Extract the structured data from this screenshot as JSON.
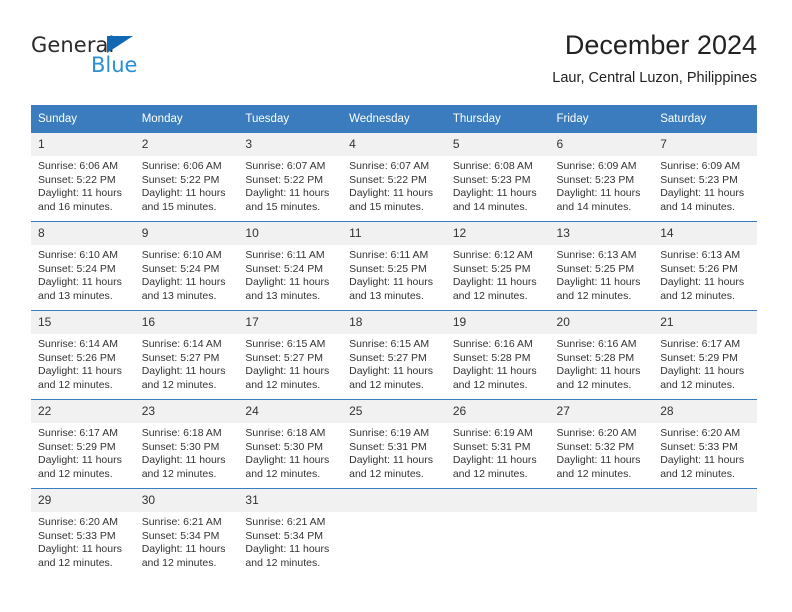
{
  "brand": {
    "name_part1": "General",
    "name_part2": "Blue",
    "triangle_color": "#1268b3",
    "blue_color": "#2a8fd4"
  },
  "header": {
    "title": "December 2024",
    "subtitle": "Laur, Central Luzon, Philippines"
  },
  "calendar": {
    "accent_color": "#3a7cbd",
    "daynum_bg": "#f1f1f1",
    "weekdays": [
      "Sunday",
      "Monday",
      "Tuesday",
      "Wednesday",
      "Thursday",
      "Friday",
      "Saturday"
    ],
    "weeks": [
      [
        {
          "day": "1",
          "sunrise": "Sunrise: 6:06 AM",
          "sunset": "Sunset: 5:22 PM",
          "daylight1": "Daylight: 11 hours",
          "daylight2": "and 16 minutes."
        },
        {
          "day": "2",
          "sunrise": "Sunrise: 6:06 AM",
          "sunset": "Sunset: 5:22 PM",
          "daylight1": "Daylight: 11 hours",
          "daylight2": "and 15 minutes."
        },
        {
          "day": "3",
          "sunrise": "Sunrise: 6:07 AM",
          "sunset": "Sunset: 5:22 PM",
          "daylight1": "Daylight: 11 hours",
          "daylight2": "and 15 minutes."
        },
        {
          "day": "4",
          "sunrise": "Sunrise: 6:07 AM",
          "sunset": "Sunset: 5:22 PM",
          "daylight1": "Daylight: 11 hours",
          "daylight2": "and 15 minutes."
        },
        {
          "day": "5",
          "sunrise": "Sunrise: 6:08 AM",
          "sunset": "Sunset: 5:23 PM",
          "daylight1": "Daylight: 11 hours",
          "daylight2": "and 14 minutes."
        },
        {
          "day": "6",
          "sunrise": "Sunrise: 6:09 AM",
          "sunset": "Sunset: 5:23 PM",
          "daylight1": "Daylight: 11 hours",
          "daylight2": "and 14 minutes."
        },
        {
          "day": "7",
          "sunrise": "Sunrise: 6:09 AM",
          "sunset": "Sunset: 5:23 PM",
          "daylight1": "Daylight: 11 hours",
          "daylight2": "and 14 minutes."
        }
      ],
      [
        {
          "day": "8",
          "sunrise": "Sunrise: 6:10 AM",
          "sunset": "Sunset: 5:24 PM",
          "daylight1": "Daylight: 11 hours",
          "daylight2": "and 13 minutes."
        },
        {
          "day": "9",
          "sunrise": "Sunrise: 6:10 AM",
          "sunset": "Sunset: 5:24 PM",
          "daylight1": "Daylight: 11 hours",
          "daylight2": "and 13 minutes."
        },
        {
          "day": "10",
          "sunrise": "Sunrise: 6:11 AM",
          "sunset": "Sunset: 5:24 PM",
          "daylight1": "Daylight: 11 hours",
          "daylight2": "and 13 minutes."
        },
        {
          "day": "11",
          "sunrise": "Sunrise: 6:11 AM",
          "sunset": "Sunset: 5:25 PM",
          "daylight1": "Daylight: 11 hours",
          "daylight2": "and 13 minutes."
        },
        {
          "day": "12",
          "sunrise": "Sunrise: 6:12 AM",
          "sunset": "Sunset: 5:25 PM",
          "daylight1": "Daylight: 11 hours",
          "daylight2": "and 12 minutes."
        },
        {
          "day": "13",
          "sunrise": "Sunrise: 6:13 AM",
          "sunset": "Sunset: 5:25 PM",
          "daylight1": "Daylight: 11 hours",
          "daylight2": "and 12 minutes."
        },
        {
          "day": "14",
          "sunrise": "Sunrise: 6:13 AM",
          "sunset": "Sunset: 5:26 PM",
          "daylight1": "Daylight: 11 hours",
          "daylight2": "and 12 minutes."
        }
      ],
      [
        {
          "day": "15",
          "sunrise": "Sunrise: 6:14 AM",
          "sunset": "Sunset: 5:26 PM",
          "daylight1": "Daylight: 11 hours",
          "daylight2": "and 12 minutes."
        },
        {
          "day": "16",
          "sunrise": "Sunrise: 6:14 AM",
          "sunset": "Sunset: 5:27 PM",
          "daylight1": "Daylight: 11 hours",
          "daylight2": "and 12 minutes."
        },
        {
          "day": "17",
          "sunrise": "Sunrise: 6:15 AM",
          "sunset": "Sunset: 5:27 PM",
          "daylight1": "Daylight: 11 hours",
          "daylight2": "and 12 minutes."
        },
        {
          "day": "18",
          "sunrise": "Sunrise: 6:15 AM",
          "sunset": "Sunset: 5:27 PM",
          "daylight1": "Daylight: 11 hours",
          "daylight2": "and 12 minutes."
        },
        {
          "day": "19",
          "sunrise": "Sunrise: 6:16 AM",
          "sunset": "Sunset: 5:28 PM",
          "daylight1": "Daylight: 11 hours",
          "daylight2": "and 12 minutes."
        },
        {
          "day": "20",
          "sunrise": "Sunrise: 6:16 AM",
          "sunset": "Sunset: 5:28 PM",
          "daylight1": "Daylight: 11 hours",
          "daylight2": "and 12 minutes."
        },
        {
          "day": "21",
          "sunrise": "Sunrise: 6:17 AM",
          "sunset": "Sunset: 5:29 PM",
          "daylight1": "Daylight: 11 hours",
          "daylight2": "and 12 minutes."
        }
      ],
      [
        {
          "day": "22",
          "sunrise": "Sunrise: 6:17 AM",
          "sunset": "Sunset: 5:29 PM",
          "daylight1": "Daylight: 11 hours",
          "daylight2": "and 12 minutes."
        },
        {
          "day": "23",
          "sunrise": "Sunrise: 6:18 AM",
          "sunset": "Sunset: 5:30 PM",
          "daylight1": "Daylight: 11 hours",
          "daylight2": "and 12 minutes."
        },
        {
          "day": "24",
          "sunrise": "Sunrise: 6:18 AM",
          "sunset": "Sunset: 5:30 PM",
          "daylight1": "Daylight: 11 hours",
          "daylight2": "and 12 minutes."
        },
        {
          "day": "25",
          "sunrise": "Sunrise: 6:19 AM",
          "sunset": "Sunset: 5:31 PM",
          "daylight1": "Daylight: 11 hours",
          "daylight2": "and 12 minutes."
        },
        {
          "day": "26",
          "sunrise": "Sunrise: 6:19 AM",
          "sunset": "Sunset: 5:31 PM",
          "daylight1": "Daylight: 11 hours",
          "daylight2": "and 12 minutes."
        },
        {
          "day": "27",
          "sunrise": "Sunrise: 6:20 AM",
          "sunset": "Sunset: 5:32 PM",
          "daylight1": "Daylight: 11 hours",
          "daylight2": "and 12 minutes."
        },
        {
          "day": "28",
          "sunrise": "Sunrise: 6:20 AM",
          "sunset": "Sunset: 5:33 PM",
          "daylight1": "Daylight: 11 hours",
          "daylight2": "and 12 minutes."
        }
      ],
      [
        {
          "day": "29",
          "sunrise": "Sunrise: 6:20 AM",
          "sunset": "Sunset: 5:33 PM",
          "daylight1": "Daylight: 11 hours",
          "daylight2": "and 12 minutes."
        },
        {
          "day": "30",
          "sunrise": "Sunrise: 6:21 AM",
          "sunset": "Sunset: 5:34 PM",
          "daylight1": "Daylight: 11 hours",
          "daylight2": "and 12 minutes."
        },
        {
          "day": "31",
          "sunrise": "Sunrise: 6:21 AM",
          "sunset": "Sunset: 5:34 PM",
          "daylight1": "Daylight: 11 hours",
          "daylight2": "and 12 minutes."
        },
        {
          "day": "",
          "sunrise": "",
          "sunset": "",
          "daylight1": "",
          "daylight2": ""
        },
        {
          "day": "",
          "sunrise": "",
          "sunset": "",
          "daylight1": "",
          "daylight2": ""
        },
        {
          "day": "",
          "sunrise": "",
          "sunset": "",
          "daylight1": "",
          "daylight2": ""
        },
        {
          "day": "",
          "sunrise": "",
          "sunset": "",
          "daylight1": "",
          "daylight2": ""
        }
      ]
    ]
  }
}
